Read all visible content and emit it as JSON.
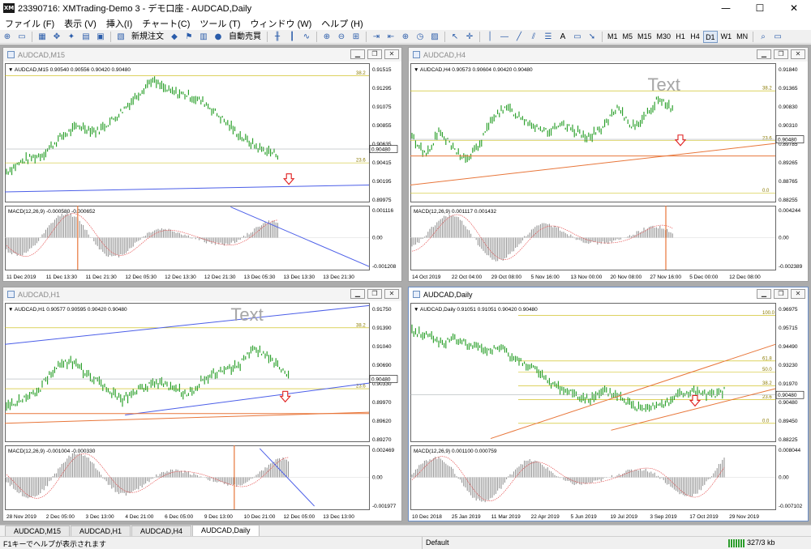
{
  "window": {
    "title": "23390716: XMTrading-Demo 3 - デモ口座 - AUDCAD,Daily",
    "app_icon": "XM",
    "minimize": "—",
    "maximize": "☐",
    "close": "✕"
  },
  "menu": [
    "ファイル (F)",
    "表示 (V)",
    "挿入(I)",
    "チャート(C)",
    "ツール (T)",
    "ウィンドウ (W)",
    "ヘルプ (H)"
  ],
  "toolbar": {
    "new_order": "新規注文",
    "autotrade": "自動売買",
    "text_tool": "A",
    "timeframes": [
      "M1",
      "M5",
      "M15",
      "M30",
      "H1",
      "H4",
      "D1",
      "W1",
      "MN"
    ],
    "active_timeframe": "D1"
  },
  "charts": [
    {
      "id": "m15",
      "window_title": "AUDCAD,M15",
      "info": "▼ AUDCAD,M15  0.90540 0.90556 0.90420 0.90480",
      "active": false,
      "price_scale": [
        "0.91515",
        "0.91295",
        "0.91075",
        "0.90855",
        "0.90635",
        "0.90415",
        "0.90195",
        "0.89975"
      ],
      "current_price": "0.90480",
      "fib": [
        "38.2",
        "23.6"
      ],
      "macd_label": "MACD(12,26,9) -0.000580 -0.000652",
      "macd_scale": [
        "0.001116",
        "0.00",
        "-0.001208"
      ],
      "time_axis": [
        "11 Dec 2019",
        "11 Dec 13:30",
        "11 Dec 21:30",
        "12 Dec 05:30",
        "12 Dec 13:30",
        "12 Dec 21:30",
        "13 Dec 05:30",
        "13 Dec 13:30",
        "13 Dec 21:30"
      ],
      "text_object": ""
    },
    {
      "id": "h4",
      "window_title": "AUDCAD,H4",
      "info": "▼ AUDCAD,H4  0.90573 0.90604 0.90420 0.90480",
      "active": false,
      "price_scale": [
        "0.91840",
        "0.91365",
        "0.90830",
        "0.90310",
        "0.89785",
        "0.89265",
        "0.88765",
        "0.88255"
      ],
      "current_price": "0.90480",
      "fib": [
        "38.2",
        "23.6",
        "0.0"
      ],
      "macd_label": "MACD(12,26,9) 0.001117 0.001432",
      "macd_scale": [
        "0.004244",
        "0.00",
        "-0.002389"
      ],
      "time_axis": [
        "14 Oct 2019",
        "22 Oct 04:00",
        "29 Oct 08:00",
        "5 Nov 16:00",
        "13 Nov 00:00",
        "20 Nov 08:00",
        "27 Nov 16:00",
        "5 Dec 00:00",
        "12 Dec 08:00"
      ],
      "text_object": "Text"
    },
    {
      "id": "h1",
      "window_title": "AUDCAD,H1",
      "info": "▼ AUDCAD,H1  0.90577 0.90595 0.90420 0.90480",
      "active": false,
      "price_scale": [
        "0.91750",
        "0.91390",
        "0.91040",
        "0.90690",
        "0.90330",
        "0.89970",
        "0.89620",
        "0.89270"
      ],
      "current_price": "0.90480",
      "fib": [
        "38.2",
        "23.6"
      ],
      "macd_label": "MACD(12,26,9) -0.001004 -0.000330",
      "macd_scale": [
        "0.002469",
        "0.00",
        "-0.001977"
      ],
      "time_axis": [
        "28 Nov 2019",
        "2 Dec 05:00",
        "3 Dec 13:00",
        "4 Dec 21:00",
        "6 Dec 05:00",
        "9 Dec 13:00",
        "10 Dec 21:00",
        "12 Dec 05:00",
        "13 Dec 13:00"
      ],
      "text_object": "Text"
    },
    {
      "id": "daily",
      "window_title": "AUDCAD,Daily",
      "info": "▼ AUDCAD,Daily  0.91051 0.91051 0.90420 0.90480",
      "active": true,
      "price_scale": [
        "0.96975",
        "0.95715",
        "0.94490",
        "0.93230",
        "0.91970",
        "0.90480",
        "0.89450",
        "0.88225"
      ],
      "current_price": "0.90480",
      "fib": [
        "100.0",
        "61.8",
        "50.0",
        "38.2",
        "23.6",
        "0.0"
      ],
      "macd_label": "MACD(12,26,9) 0.001100 0.000759",
      "macd_scale": [
        "0.008044",
        "0.00",
        "-0.007102"
      ],
      "time_axis": [
        "10 Dec 2018",
        "25 Jan 2019",
        "11 Mar 2019",
        "22 Apr 2019",
        "5 Jun 2019",
        "19 Jul 2019",
        "3 Sep 2019",
        "17 Oct 2019",
        "29 Nov 2019"
      ],
      "text_object": ""
    }
  ],
  "tabs": [
    "AUDCAD,M15",
    "AUDCAD,H1",
    "AUDCAD,H4",
    "AUDCAD,Daily"
  ],
  "active_tab": "AUDCAD,Daily",
  "status": {
    "help": "F1キーでヘルプが表示されます",
    "profile": "Default",
    "connection": "327/3 kb"
  },
  "colors": {
    "candle": "#1f9a1f",
    "trend_blue": "#4b5ee8",
    "trend_orange": "#e8763a",
    "fib": "#c9b800",
    "arrow": "#e02020",
    "macd_bars": "#8c8c8c",
    "macd_signal": "#e23c3c"
  }
}
